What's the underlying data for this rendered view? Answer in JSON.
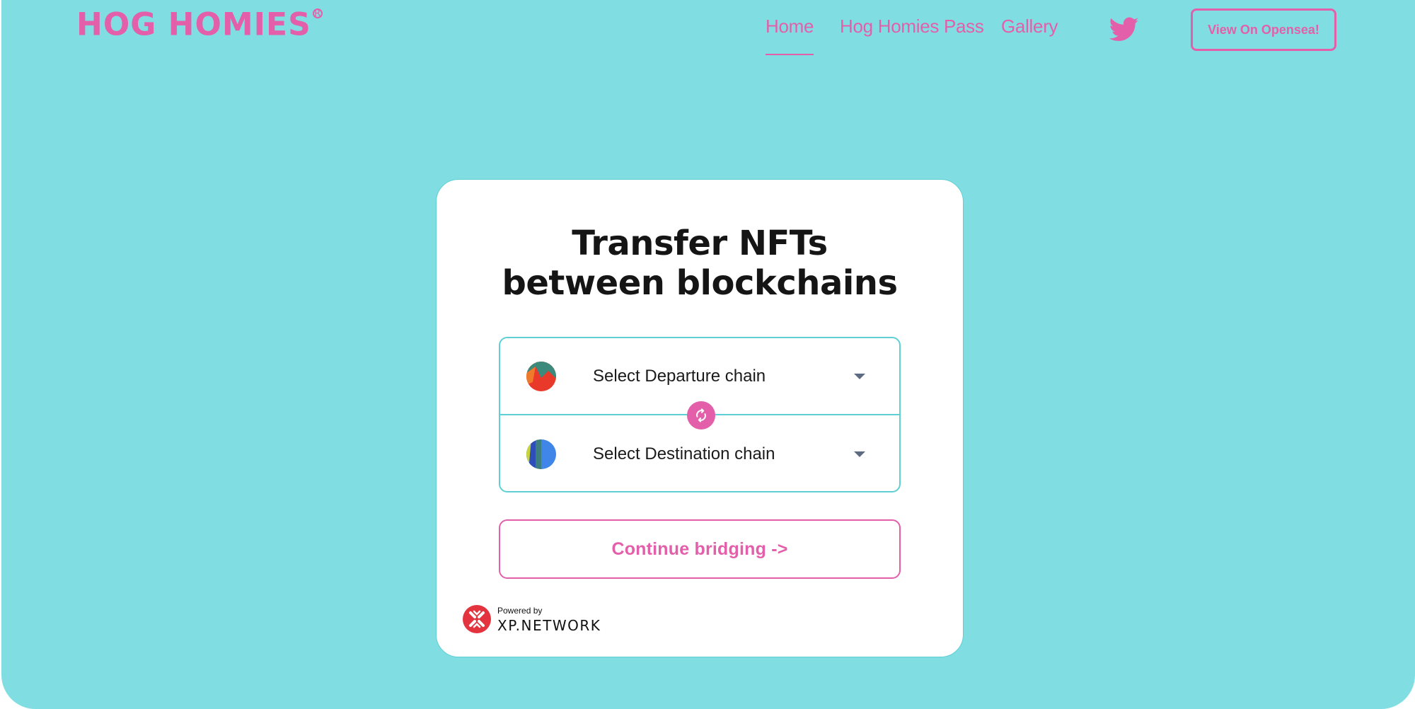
{
  "header": {
    "logo_text": "HOG HOMIES",
    "logo_mark": "R",
    "nav": [
      {
        "label": "Home",
        "active": true
      },
      {
        "label": "Hog Homies Pass",
        "active": false
      },
      {
        "label": "Gallery",
        "active": false
      }
    ],
    "twitter_icon": "twitter-icon",
    "opensea_label": "View On Opensea!"
  },
  "card": {
    "title_line1": "Transfer NFTs",
    "title_line2": "between blockchains",
    "departure_label": "Select Departure chain",
    "destination_label": "Select Destination chain",
    "swap_icon": "swap-icon",
    "continue_label": "Continue bridging ->",
    "powered_by": "Powered by",
    "powered_name": "XP.NETWORK"
  },
  "colors": {
    "background": "#80dee3",
    "accent": "#e35fa9",
    "border": "#5fcfd4",
    "card": "#ffffff"
  }
}
